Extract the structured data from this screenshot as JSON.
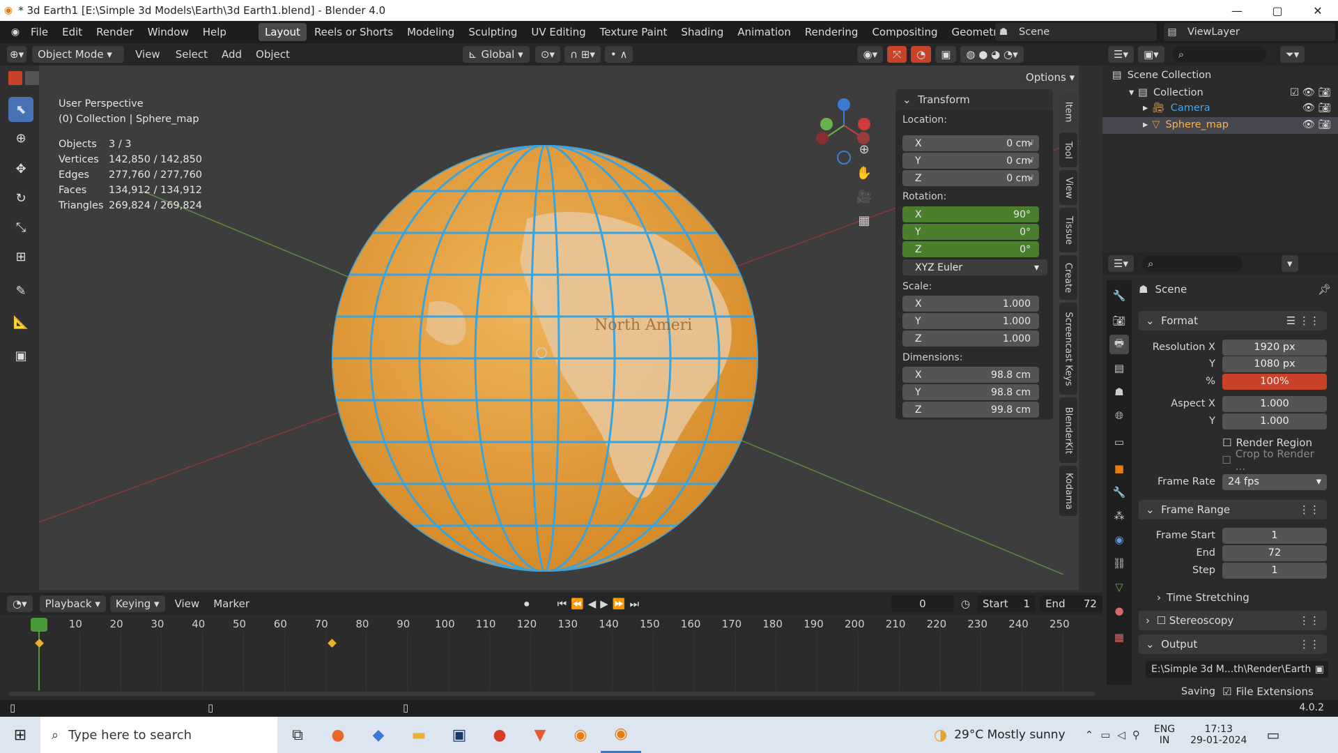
{
  "window": {
    "title": "* 3d Earth1 [E:\\Simple 3d Models\\Earth\\3d Earth1.blend] - Blender 4.0",
    "min": "—",
    "max": "▢",
    "close": "✕"
  },
  "menu": {
    "items": [
      "File",
      "Edit",
      "Render",
      "Window",
      "Help"
    ]
  },
  "workspaces": [
    "Layout",
    "Reels or Shorts",
    "Modeling",
    "Sculpting",
    "UV Editing",
    "Texture Paint",
    "Shading",
    "Animation",
    "Rendering",
    "Compositing",
    "Geometry Nodes"
  ],
  "scene": {
    "label": "Scene",
    "viewlayer": "ViewLayer"
  },
  "header3d": {
    "mode": "Object Mode",
    "view": "View",
    "select": "Select",
    "add": "Add",
    "object": "Object",
    "orientation": "Global",
    "options": "Options"
  },
  "overlay": {
    "perspective": "User Perspective",
    "collection": "(0) Collection | Sphere_map"
  },
  "stats": [
    {
      "k": "Objects",
      "v": "3 / 3"
    },
    {
      "k": "Vertices",
      "v": "142,850 / 142,850"
    },
    {
      "k": "Edges",
      "v": "277,760 / 277,760"
    },
    {
      "k": "Faces",
      "v": "134,912 / 134,912"
    },
    {
      "k": "Triangles",
      "v": "269,824 / 269,824"
    }
  ],
  "globe_text": "North Ameri",
  "transform": {
    "title": "Transform",
    "location_label": "Location:",
    "location": [
      {
        "a": "X",
        "v": "0 cm"
      },
      {
        "a": "Y",
        "v": "0 cm"
      },
      {
        "a": "Z",
        "v": "0 cm"
      }
    ],
    "rotation_label": "Rotation:",
    "rotation": [
      {
        "a": "X",
        "v": "90°"
      },
      {
        "a": "Y",
        "v": "0°"
      },
      {
        "a": "Z",
        "v": "0°"
      }
    ],
    "rotation_mode": "XYZ Euler",
    "scale_label": "Scale:",
    "scale": [
      {
        "a": "X",
        "v": "1.000"
      },
      {
        "a": "Y",
        "v": "1.000"
      },
      {
        "a": "Z",
        "v": "1.000"
      }
    ],
    "dimensions_label": "Dimensions:",
    "dimensions": [
      {
        "a": "X",
        "v": "98.8 cm"
      },
      {
        "a": "Y",
        "v": "98.8 cm"
      },
      {
        "a": "Z",
        "v": "99.8 cm"
      }
    ]
  },
  "side_tabs": [
    "Item",
    "Tool",
    "View",
    "Tissue",
    "Create",
    "Screencast Keys",
    "BlenderKit",
    "Kodama"
  ],
  "outliner": {
    "root": "Scene Collection",
    "collection": "Collection",
    "items": [
      "Camera",
      "Sphere_map"
    ]
  },
  "properties": {
    "scene": "Scene",
    "format": "Format",
    "res_x_label": "Resolution X",
    "res_x": "1920 px",
    "res_y_label": "Y",
    "res_y": "1080 px",
    "pct_label": "%",
    "pct": "100%",
    "aspect_x_label": "Aspect X",
    "aspect_x": "1.000",
    "aspect_y_label": "Y",
    "aspect_y": "1.000",
    "render_region": "Render Region",
    "crop": "Crop to Render ...",
    "frame_rate_label": "Frame Rate",
    "frame_rate": "24 fps",
    "frame_range": "Frame Range",
    "start_label": "Frame Start",
    "start": "1",
    "end_label": "End",
    "end": "72",
    "step_label": "Step",
    "step": "1",
    "time_stretching": "Time Stretching",
    "stereoscopy": "Stereoscopy",
    "output": "Output",
    "output_path": "E:\\Simple 3d M...th\\Render\\Earth",
    "saving_label": "Saving",
    "file_ext": "File Extensions"
  },
  "timeline": {
    "playback": "Playback",
    "keying": "Keying",
    "view": "View",
    "marker": "Marker",
    "current": "0",
    "start_label": "Start",
    "start": "1",
    "end_label": "End",
    "end": "72",
    "ticks": [
      "0",
      "10",
      "20",
      "30",
      "40",
      "50",
      "60",
      "70",
      "80",
      "90",
      "100",
      "110",
      "120",
      "130",
      "140",
      "150",
      "160",
      "170",
      "180",
      "190",
      "200",
      "210",
      "220",
      "230",
      "240",
      "250"
    ]
  },
  "version": "4.0.2",
  "taskbar": {
    "search": "Type here to search",
    "weather": "29°C  Mostly sunny",
    "lang1": "ENG",
    "lang2": "IN",
    "time": "17:13",
    "date": "29-01-2024"
  }
}
